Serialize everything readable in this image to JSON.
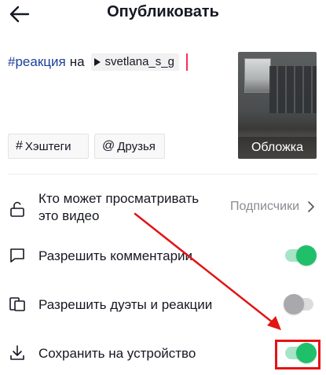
{
  "header": {
    "title": "Опубликовать",
    "back_icon": "arrow-left-icon"
  },
  "caption": {
    "hashtag": "#реакция",
    "connector": "на",
    "mention": "svetlana_s_g",
    "mention_icon": "play-icon"
  },
  "cover": {
    "label": "Обложка"
  },
  "chips": {
    "hashtags": {
      "symbol": "#",
      "label": "Хэштеги"
    },
    "friends": {
      "symbol": "@",
      "label": "Друзья"
    }
  },
  "settings": {
    "privacy": {
      "icon": "lock-icon",
      "label_line1": "Кто может просматривать",
      "label_line2": "это видео",
      "value": "Подписчики"
    },
    "comments": {
      "icon": "comment-icon",
      "label": "Разрешить комментарии",
      "enabled": true
    },
    "duets": {
      "icon": "duet-icon",
      "label": "Разрешить дуэты и реакции",
      "enabled": false
    },
    "save": {
      "icon": "download-icon",
      "label": "Сохранить на устройство",
      "enabled": true
    }
  },
  "colors": {
    "accent_pink": "#fe2c55",
    "toggle_on": "#20c06a",
    "toggle_off": "#a9a9ad",
    "annotation_red": "#e31414",
    "hashtag_blue": "#1d3f9b"
  }
}
